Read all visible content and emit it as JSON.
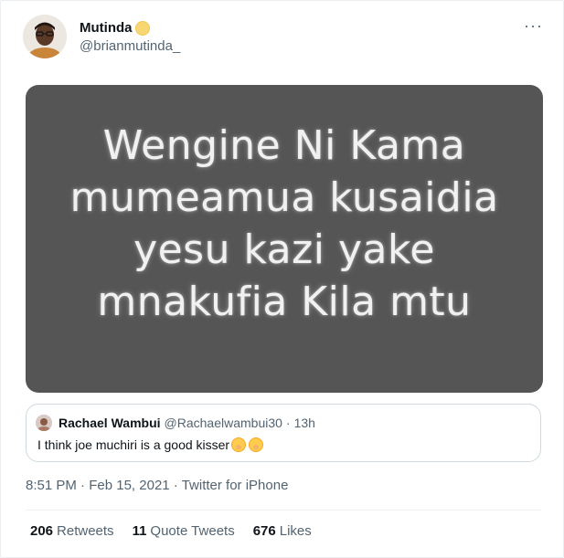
{
  "tweet": {
    "author_name": "Mutinda",
    "author_handle": "@brianmutinda_",
    "more_icon": "more-horizontal-icon",
    "media_lines": [
      "Wengine Ni Kama",
      "mumeamua kusaidia",
      "yesu kazi yake",
      "mnakufia Kila mtu"
    ],
    "quote": {
      "name": "Rachael Wambui",
      "handle": "@Rachaelwambui30",
      "separator": "·",
      "time": "13h",
      "text": "I think joe muchiri is a good kisser"
    },
    "time": "8:51 PM",
    "separator": "·",
    "date": "Feb 15, 2021",
    "source": "Twitter for iPhone",
    "stats": {
      "retweets_count": "206",
      "retweets_label": "Retweets",
      "quotes_count": "11",
      "quotes_label": "Quote Tweets",
      "likes_count": "676",
      "likes_label": "Likes"
    }
  }
}
